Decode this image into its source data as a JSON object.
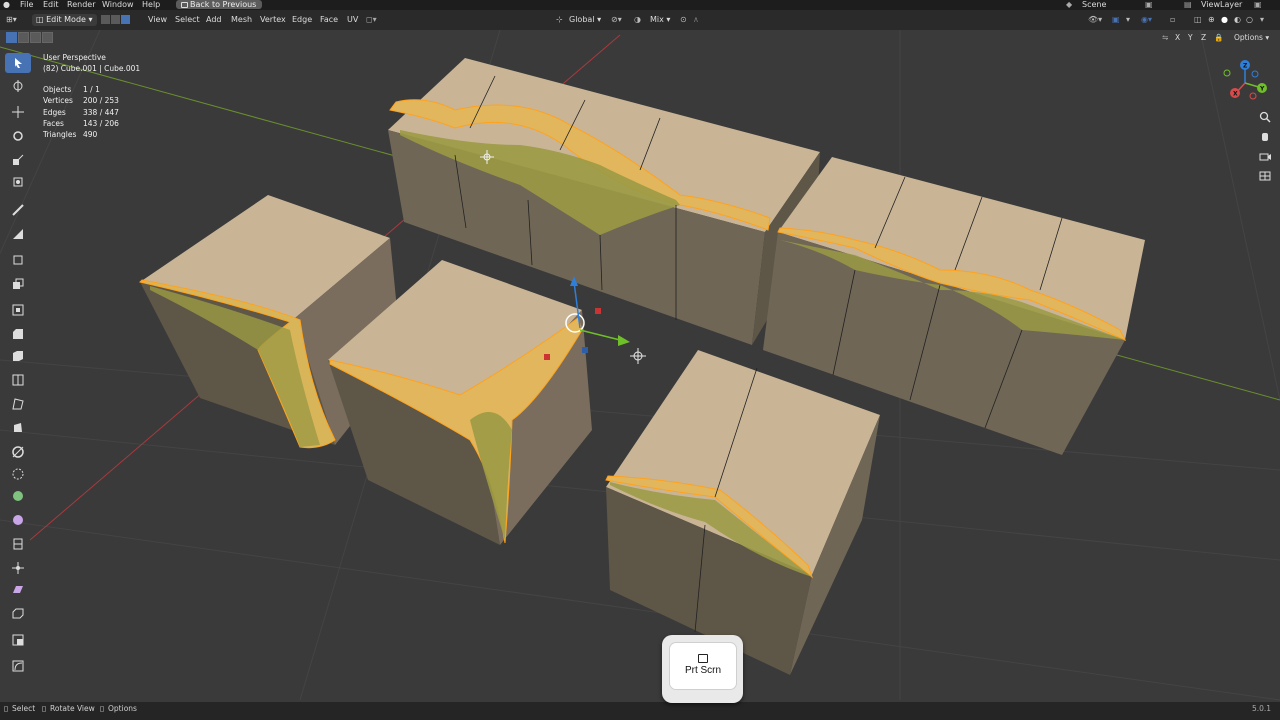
{
  "menubar": {
    "items": [
      "File",
      "Edit",
      "Render",
      "Window",
      "Help"
    ],
    "back_button": "Back to Previous",
    "scene": "Scene",
    "view_layer": "ViewLayer"
  },
  "header": {
    "mode": "Edit Mode",
    "menus": [
      "View",
      "Select",
      "Add",
      "Mesh",
      "Vertex",
      "Edge",
      "Face",
      "UV"
    ],
    "transform_orientation": "Global",
    "proportional_mode": "Mix"
  },
  "viewport_header": {
    "axes": [
      "X",
      "Y",
      "Z"
    ],
    "options_label": "Options"
  },
  "overlay": {
    "view_name": "User Perspective",
    "object_name": "(82) Cube.001 | Cube.001",
    "stats": [
      {
        "label": "Objects",
        "value": "1 / 1"
      },
      {
        "label": "Vertices",
        "value": "200 / 253"
      },
      {
        "label": "Edges",
        "value": "338 / 447"
      },
      {
        "label": "Faces",
        "value": "143 / 206"
      },
      {
        "label": "Triangles",
        "value": "490"
      }
    ]
  },
  "gizmo": {
    "x": "X",
    "y": "Y",
    "z": "Z"
  },
  "toolbar": {
    "tools": [
      "select-box",
      "cursor",
      "move",
      "rotate",
      "scale",
      "transform",
      "annotate",
      "measure",
      "add-cube",
      "extrude-region",
      "inset-faces",
      "bevel",
      "loop-cut",
      "knife",
      "poly-build",
      "spin",
      "smooth",
      "edge-slide",
      "shrink-fatten",
      "shear",
      "rip-region",
      "to-sphere",
      "randomize",
      "push-pull"
    ]
  },
  "status_bar": {
    "select": "Select",
    "rotate_view": "Rotate View",
    "options": "Options",
    "version": "5.0.1"
  },
  "key_overlay": {
    "label": "Prt Scrn"
  },
  "colors": {
    "accent": "#4772b3",
    "selection": "#ffa21c",
    "viewport_bg": "#3a3a3a"
  }
}
